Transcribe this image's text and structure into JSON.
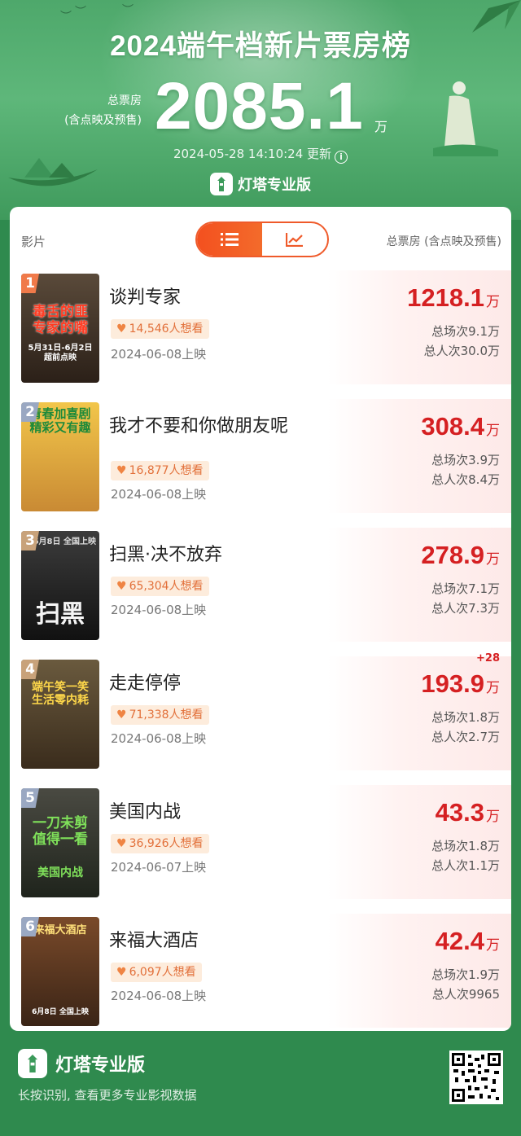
{
  "header": {
    "title": "2024端午档新片票房榜",
    "total_label_line1": "总票房",
    "total_label_line2": "(含点映及预售)",
    "total_value": "2085.1",
    "total_unit": "万",
    "update_time": "2024-05-28 14:10:24 更新",
    "info_icon": "info-icon",
    "brand": "灯塔专业版"
  },
  "table": {
    "col_film": "影片",
    "col_total": "总票房 (含点映及预售)",
    "toggle": [
      {
        "icon": "list-icon",
        "active": true
      },
      {
        "icon": "trend-chart-icon",
        "active": false
      }
    ]
  },
  "films": [
    {
      "rank": "1",
      "name": "谈判专家",
      "want": "14,546人想看",
      "release": "2024-06-08上映",
      "box": "1218.1",
      "unit": "万",
      "delta": "",
      "shows": "总场次9.1万",
      "viewers": "总人次30.0万",
      "poster_text": "毒舌的匪 专家的嘴",
      "poster_sub": "5月31日-6月2日 超前点映"
    },
    {
      "rank": "2",
      "name": "我才不要和你做朋友呢",
      "want": "16,877人想看",
      "release": "2024-06-08上映",
      "box": "308.4",
      "unit": "万",
      "delta": "",
      "shows": "总场次3.9万",
      "viewers": "总人次8.4万",
      "poster_text": "青春加喜剧 精彩又有趣",
      "poster_sub": ""
    },
    {
      "rank": "3",
      "name": "扫黑·决不放弃",
      "want": "65,304人想看",
      "release": "2024-06-08上映",
      "box": "278.9",
      "unit": "万",
      "delta": "",
      "shows": "总场次7.1万",
      "viewers": "总人次7.3万",
      "poster_text": "扫黑",
      "poster_sub": "6月8日 全国上映"
    },
    {
      "rank": "4",
      "name": "走走停停",
      "want": "71,338人想看",
      "release": "2024-06-08上映",
      "box": "193.9",
      "unit": "万",
      "delta": "+28",
      "shows": "总场次1.8万",
      "viewers": "总人次2.7万",
      "poster_text": "端午笑一笑 生活零内耗",
      "poster_sub": ""
    },
    {
      "rank": "5",
      "name": "美国内战",
      "want": "36,926人想看",
      "release": "2024-06-07上映",
      "box": "43.3",
      "unit": "万",
      "delta": "",
      "shows": "总场次1.8万",
      "viewers": "总人次1.1万",
      "poster_text": "一刀未剪 值得一看",
      "poster_sub": "美国内战"
    },
    {
      "rank": "6",
      "name": "来福大酒店",
      "want": "6,097人想看",
      "release": "2024-06-08上映",
      "box": "42.4",
      "unit": "万",
      "delta": "",
      "shows": "总场次1.9万",
      "viewers": "总人次9965",
      "poster_text": "来福大酒店",
      "poster_sub": "6月8日 全国上映"
    }
  ],
  "footer": {
    "brand": "灯塔专业版",
    "note": "长按识别, 查看更多专业影视数据",
    "qr_icon": "qr-code-icon"
  },
  "colors": {
    "header_green": "#4ea86b",
    "footer_green": "#2f8a4e",
    "accent_orange": "#f3501f",
    "box_red": "#d52022"
  }
}
